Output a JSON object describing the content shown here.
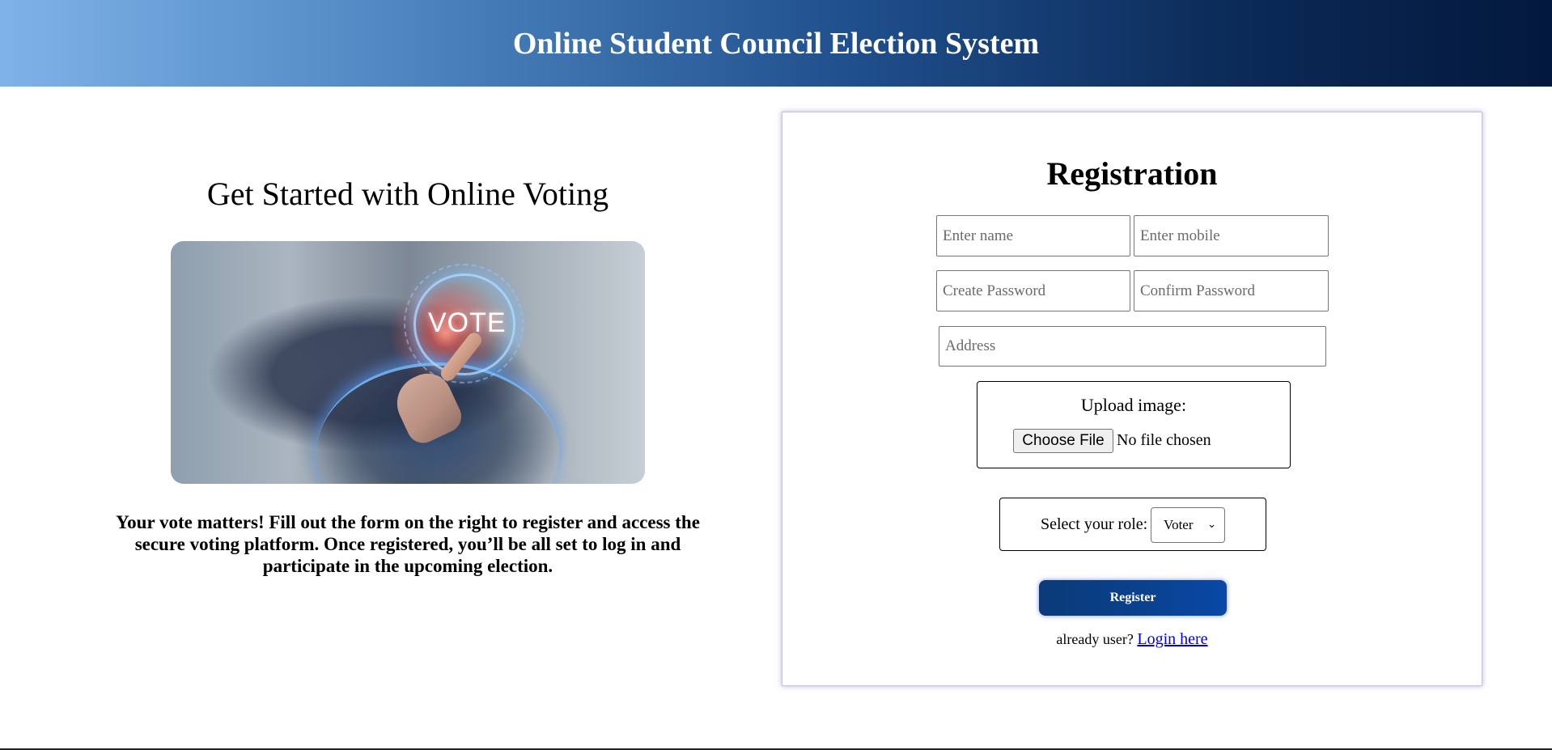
{
  "header": {
    "title": "Online Student Council Election System"
  },
  "intro": {
    "heading": "Get Started with Online Voting",
    "image_text": "VOTE",
    "description": "Your vote matters! Fill out the form on the right to register and access the secure voting platform. Once registered, you’ll be all set to log in and participate in the upcoming election."
  },
  "registration": {
    "title": "Registration",
    "fields": {
      "name_placeholder": "Enter name",
      "mobile_placeholder": "Enter mobile",
      "password_placeholder": "Create Password",
      "confirm_placeholder": "Confirm Password",
      "address_placeholder": "Address",
      "name_value": "",
      "mobile_value": "",
      "password_value": "",
      "confirm_value": "",
      "address_value": ""
    },
    "upload": {
      "label": "Upload image:",
      "button_label": "Choose File",
      "status": "No file chosen"
    },
    "role": {
      "label": "Select your role:",
      "selected": "Voter"
    },
    "register_label": "Register",
    "login_prompt": "already user?",
    "login_link": "Login here"
  },
  "icons": {
    "role_dropdown": "chevron-down-icon"
  }
}
